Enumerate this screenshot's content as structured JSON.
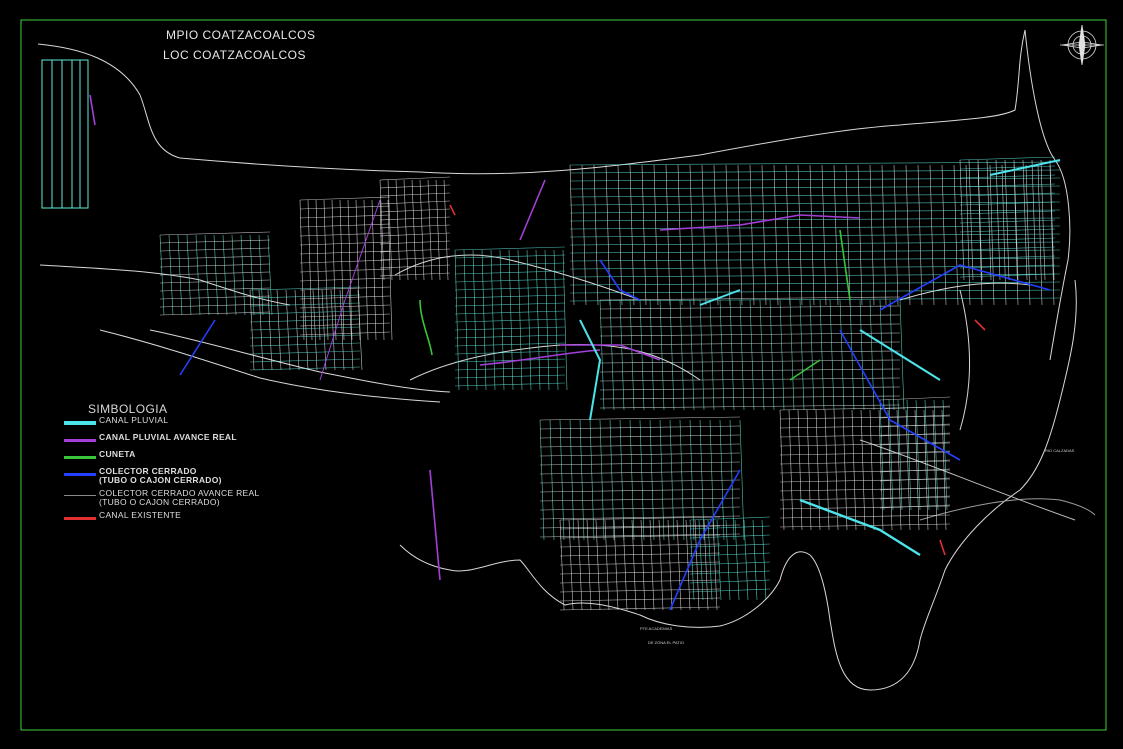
{
  "titles": {
    "municipio": "MPIO COATZACOALCOS",
    "localidad": "LOC COATZACOALCOS"
  },
  "legend": {
    "heading": "SIMBOLOGIA",
    "items": [
      {
        "label": "CANAL PLUVIAL",
        "color": "#4de3ea",
        "bold": false
      },
      {
        "label": "CANAL PLUVIAL AVANCE REAL",
        "color": "#a43fd9",
        "bold": true
      },
      {
        "label": "CUNETA",
        "color": "#39c43a",
        "bold": true
      },
      {
        "label": "COLECTOR CERRADO\n(TUBO O CAJON CERRADO)",
        "color": "#2340ff",
        "bold": true
      },
      {
        "label": "COLECTOR CERRADO AVANCE REAL\n(TUBO O CAJON CERRADO)",
        "color": "#8a8a8a",
        "bold": false
      },
      {
        "label": "CANAL EXISTENTE",
        "color": "#e03030",
        "bold": false
      }
    ]
  },
  "colors": {
    "background": "#000000",
    "frame": "#3bd23b",
    "coast": "#d8d8d8",
    "streets": "#5fe8d8",
    "street_grid": "#e6e6e6"
  },
  "map_labels": {
    "label_a": "PTE ACADEMIAS",
    "label_b": "DE ZONA EL PATIO",
    "label_c": "RIO CALZADAS"
  },
  "icons": {
    "north_arrow": "north-arrow-icon"
  }
}
